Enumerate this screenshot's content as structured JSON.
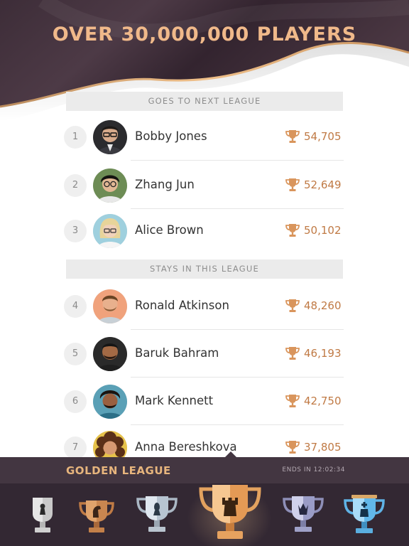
{
  "header": {
    "headline": "OVER 30,000,000 PLAYERS"
  },
  "sections": {
    "promote": "GOES TO NEXT LEAGUE",
    "stay": "STAYS IN THIS LEAGUE"
  },
  "players": [
    {
      "rank": "1",
      "name": "Bobby Jones",
      "score": "54,705"
    },
    {
      "rank": "2",
      "name": "Zhang Jun",
      "score": "52,649"
    },
    {
      "rank": "3",
      "name": "Alice Brown",
      "score": "50,102"
    },
    {
      "rank": "4",
      "name": "Ronald Atkinson",
      "score": "48,260"
    },
    {
      "rank": "5",
      "name": "Baruk Bahram",
      "score": "46,193"
    },
    {
      "rank": "6",
      "name": "Mark Kennett",
      "score": "42,750"
    },
    {
      "rank": "7",
      "name": "Anna Bereshkova",
      "score": "37,805"
    }
  ],
  "league": {
    "name": "GOLDEN LEAGUE",
    "timer": "ENDS IN 12:02:34"
  },
  "leagues": [
    {
      "icon": "silver-pawn-trophy-icon"
    },
    {
      "icon": "bronze-knight-trophy-icon"
    },
    {
      "icon": "silver-bishop-trophy-icon"
    },
    {
      "icon": "gold-rook-trophy-icon"
    },
    {
      "icon": "platinum-queen-trophy-icon"
    },
    {
      "icon": "diamond-king-trophy-icon"
    }
  ],
  "colors": {
    "header_dark": "#3a2a36",
    "gold_accent": "#e7b57d",
    "score": "#c07a45",
    "league_bar": "#433641"
  }
}
